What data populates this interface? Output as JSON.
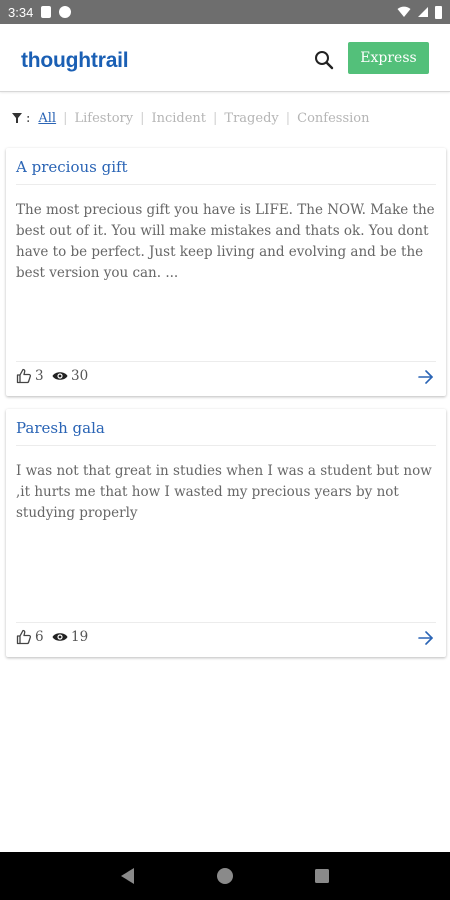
{
  "status_bar": {
    "time": "3:34"
  },
  "header": {
    "logo": "thoughtrail",
    "express_label": "Express"
  },
  "filters": {
    "colon": ":",
    "items": [
      "All",
      "Lifestory",
      "Incident",
      "Tragedy",
      "Confession"
    ],
    "active": "All"
  },
  "posts": [
    {
      "title": "A precious gift",
      "body": "The most precious gift you have is LIFE. The NOW. Make the best out of it. You will make mistakes and thats ok. You dont have to be perfect. Just keep living and evolving and be the best version you can. ...",
      "likes": "3",
      "views": "30"
    },
    {
      "title": "Paresh gala",
      "body": "I was not that great in studies when I was a student but now ,it hurts me that how I wasted  my precious years by not studying properly",
      "likes": "6",
      "views": "19"
    }
  ],
  "colors": {
    "brand": "#1a5fb4",
    "link": "#2a64b5",
    "express": "#53c07a"
  }
}
